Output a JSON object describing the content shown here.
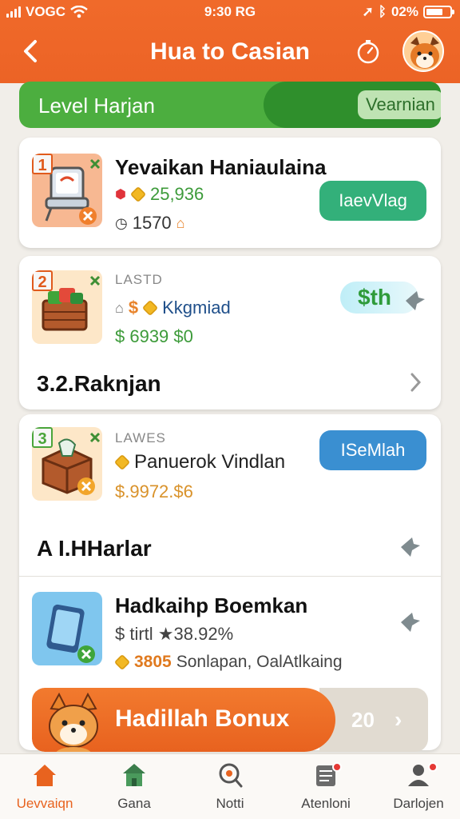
{
  "status_bar": {
    "carrier": "VOGC",
    "time": "9:30 RG",
    "battery": "02%"
  },
  "header": {
    "title": "Hua to Casian"
  },
  "level": {
    "label": "Level Harjan",
    "pill": "Vearnian"
  },
  "cards": [
    {
      "number": "1",
      "title": "Yevaikan Haniaulaina",
      "value": "25,936",
      "count": "1570",
      "button": "IaevVlag"
    },
    {
      "number": "2",
      "tag": "LASTD",
      "subtitle": "Kkgmiad",
      "price": "$ 6939 $0",
      "badge": "$th",
      "section": "3.2.Raknjan"
    },
    {
      "number": "3",
      "tag": "LAWES",
      "subtitle": "Panuerok Vindlan",
      "price": "$.9972.$6",
      "button": "ISeMlah",
      "section": "A I.HHarlar"
    },
    {
      "title": "Hadkaihp Boemkan",
      "line1": "$ tirtl ★38.92%",
      "value": "3805",
      "line2": "Sonlapan, OalAtlkaing"
    }
  ],
  "bonus": {
    "label": "Hadillah Bonux",
    "count": "20"
  },
  "nav": [
    {
      "label": "Uevvaiqn"
    },
    {
      "label": "Gana"
    },
    {
      "label": "Notti"
    },
    {
      "label": "Atenloni"
    },
    {
      "label": "Darlojen"
    }
  ],
  "colors": {
    "primary": "#ec6326",
    "green": "#4cae3f",
    "blue": "#3a8fd1",
    "teal": "#33b07a"
  }
}
